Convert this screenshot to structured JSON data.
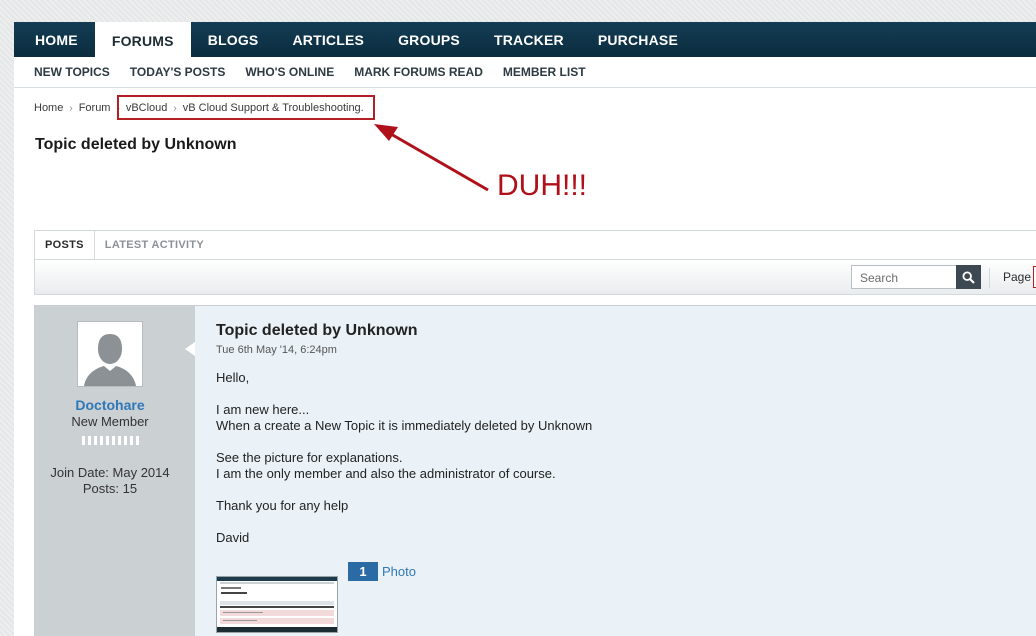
{
  "nav": {
    "tabs": [
      "HOME",
      "FORUMS",
      "BLOGS",
      "ARTICLES",
      "GROUPS",
      "TRACKER",
      "PURCHASE"
    ],
    "active_tab": "FORUMS"
  },
  "subnav": [
    "NEW TOPICS",
    "TODAY'S POSTS",
    "WHO'S ONLINE",
    "MARK FORUMS READ",
    "MEMBER LIST"
  ],
  "breadcrumb": [
    "Home",
    "Forum",
    "vBCloud",
    "vB Cloud Support & Troubleshooting."
  ],
  "page_title": "Topic deleted by Unknown",
  "annotation": {
    "text": "DUH!!!",
    "color": "#b0101a"
  },
  "tabs": [
    "POSTS",
    "LATEST ACTIVITY"
  ],
  "toolbar": {
    "search_placeholder": "Search",
    "page_label": "Page"
  },
  "post": {
    "author": {
      "name": "Doctohare",
      "title": "New Member",
      "join_date": "Join Date: May 2014",
      "posts": "Posts: 15"
    },
    "title": "Topic deleted by Unknown",
    "date": "Tue 6th May '14, 6:24pm",
    "body": [
      "Hello,",
      "",
      "I am new here...",
      "When a create a New Topic it is immediately deleted by Unknown",
      "",
      "See the picture for explanations.",
      "I am the only member and also the administrator of course.",
      "",
      "Thank you for any help",
      "",
      "David"
    ],
    "attachments": {
      "count": "1",
      "label": "Photo"
    }
  },
  "colors": {
    "nav_bg": "#0f3347",
    "link_blue": "#2f78b8",
    "highlight_red": "#b21f24",
    "post_bg": "#eaf2f7",
    "userpane_bg": "#cbd0d3"
  }
}
